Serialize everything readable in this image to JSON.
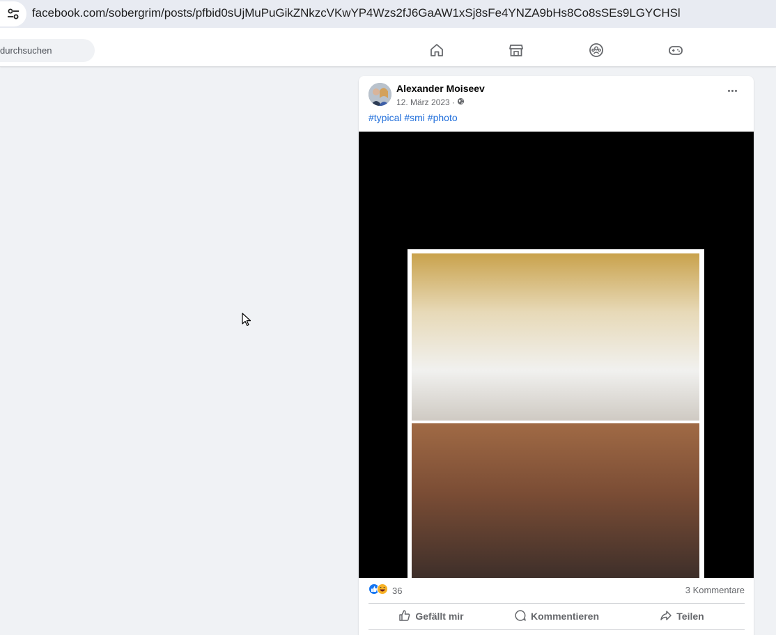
{
  "browser": {
    "url": "facebook.com/sobergrim/posts/pfbid0sUjMuPuGikZNkzcVKwYP4Wzs2fJ6GaAW1xSj8sFe4YNZA9bHs8Co8sSEs9LGYCHSl",
    "site_info_icon": "tune-icon"
  },
  "nav": {
    "search_placeholder": "durchsuchen",
    "icons": [
      "home-icon",
      "marketplace-icon",
      "groups-icon",
      "gaming-icon"
    ]
  },
  "post": {
    "author": "Alexander Moiseev",
    "date": "12. März 2023",
    "separator": "·",
    "audience_icon": "globe-icon",
    "hashtags": "#typical #smi #photo",
    "reaction_count": "36",
    "comments_label": "3 Kommentare",
    "actions": {
      "like": "Gefällt mir",
      "comment": "Kommentieren",
      "share": "Teilen"
    }
  },
  "colors": {
    "fb_blue": "#1877f2",
    "link": "#216fdb",
    "secondary_text": "#65676b",
    "page_bg": "#f0f2f5"
  }
}
